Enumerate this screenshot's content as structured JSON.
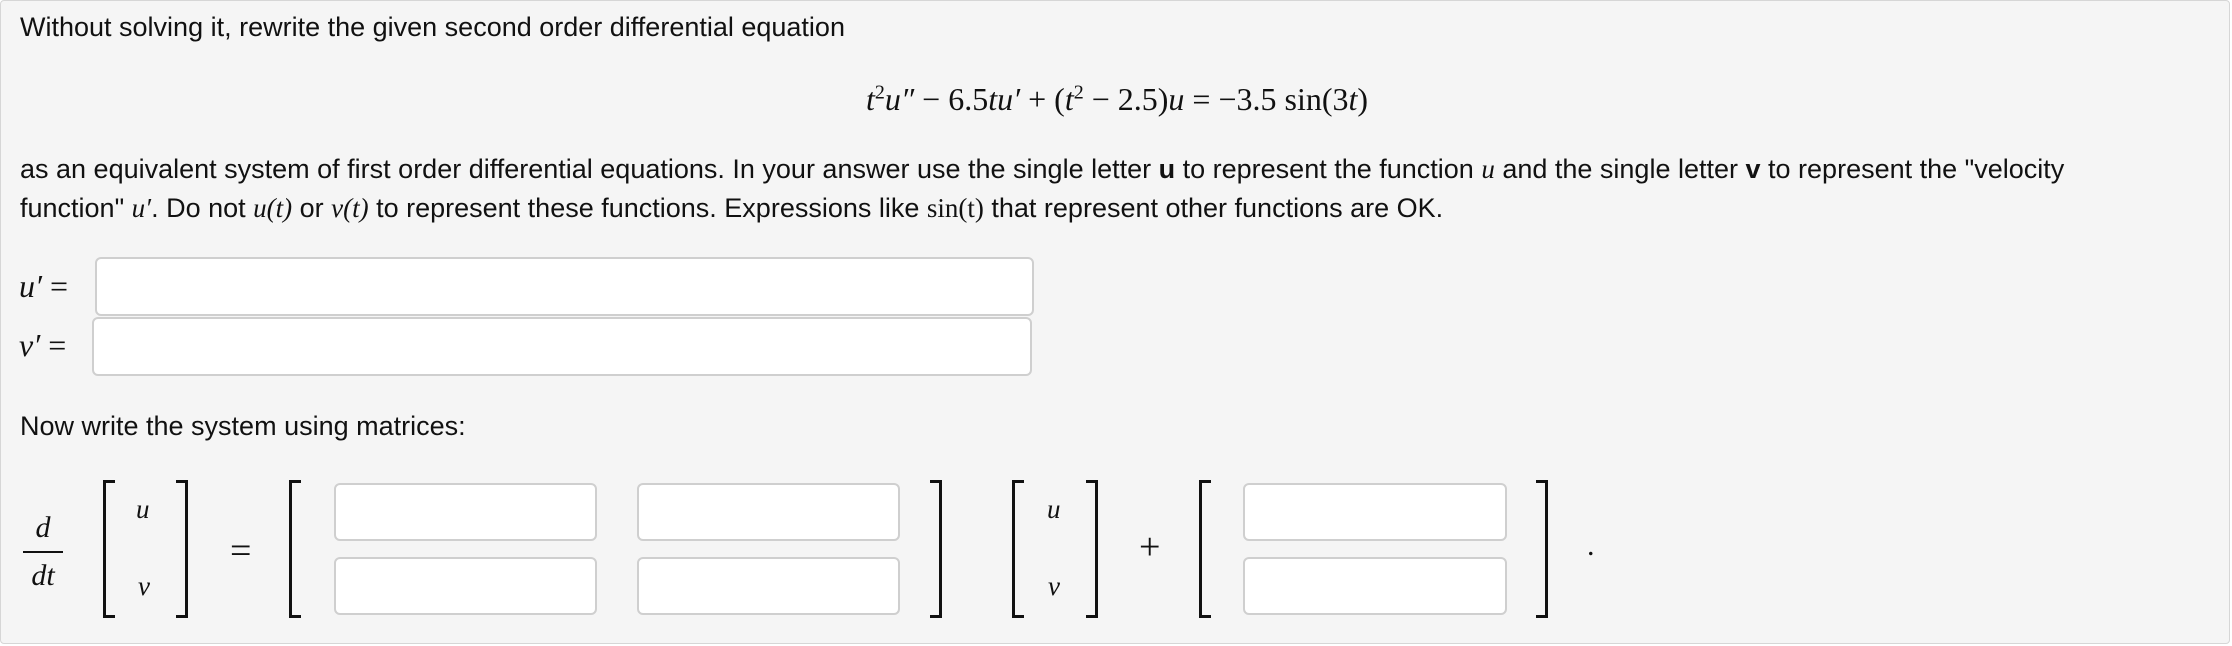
{
  "prompt": {
    "intro": "Without solving it, rewrite the given second order differential equation",
    "equation": {
      "t": "t",
      "t_exp": "2",
      "u_dd": "u″",
      "minus1": " − 6.5",
      "tu": "tu′",
      "plus1": " + (",
      "t2": "t",
      "t2_exp": "2",
      "minus2": " − 2.5)",
      "u": "u",
      "rhs": " = −3.5 sin(3",
      "rhs_t": "t",
      "rhs_close": ")"
    },
    "line2_a": "as an equivalent system of first order differential equations. In your answer use the single letter ",
    "line2_u_bold": "u",
    "line2_b": " to represent the function ",
    "line2_u_math": "u",
    "line2_c": " and the single letter ",
    "line2_v_bold": "v",
    "line2_d": " to represent the \"velocity",
    "line3_a": "function\" ",
    "line3_uprime": "u′",
    "line3_b": ". Do not ",
    "line3_ut": "u(t)",
    "line3_c": " or ",
    "line3_vt": "v(t)",
    "line3_d": " to represent these functions. Expressions like ",
    "line3_sint": "sin(t)",
    "line3_e": " that represent other functions are OK."
  },
  "system": {
    "uprime_label": "u′",
    "vprime_label": "v′",
    "equals": "="
  },
  "matrix_section": {
    "heading": "Now write the system using matrices:",
    "d": "d",
    "dt": "dt",
    "vec_u": "u",
    "vec_v": "v",
    "equals": "=",
    "plus": "+",
    "period": "."
  }
}
